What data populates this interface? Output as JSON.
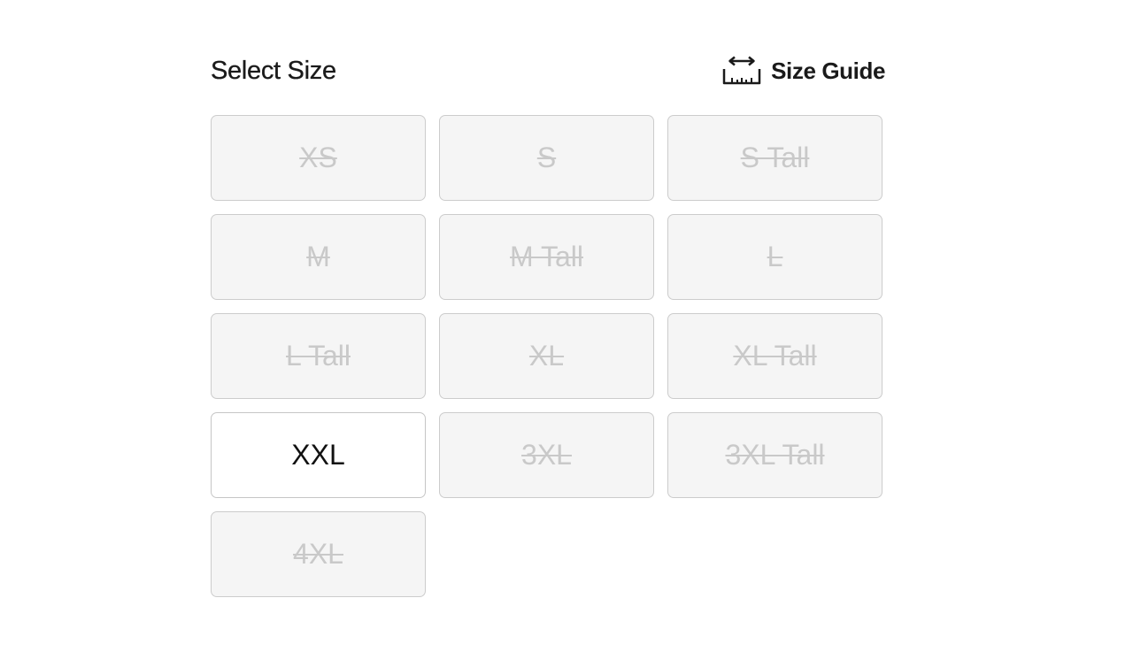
{
  "header": {
    "title": "Select Size",
    "size_guide_label": "Size Guide",
    "size_guide_icon": "ruler-icon"
  },
  "sizes": [
    {
      "label": "XS",
      "available": false
    },
    {
      "label": "S",
      "available": false
    },
    {
      "label": "S Tall",
      "available": false
    },
    {
      "label": "M",
      "available": false
    },
    {
      "label": "M Tall",
      "available": false
    },
    {
      "label": "L",
      "available": false
    },
    {
      "label": "L Tall",
      "available": false
    },
    {
      "label": "XL",
      "available": false
    },
    {
      "label": "XL Tall",
      "available": false
    },
    {
      "label": "XXL",
      "available": true
    },
    {
      "label": "3XL",
      "available": false
    },
    {
      "label": "3XL Tall",
      "available": false
    },
    {
      "label": "4XL",
      "available": false
    }
  ],
  "colors": {
    "text": "#1a1a1a",
    "unavailable_text": "#c9c9c9",
    "unavailable_bg": "#f5f5f5",
    "border": "#cccccc"
  }
}
